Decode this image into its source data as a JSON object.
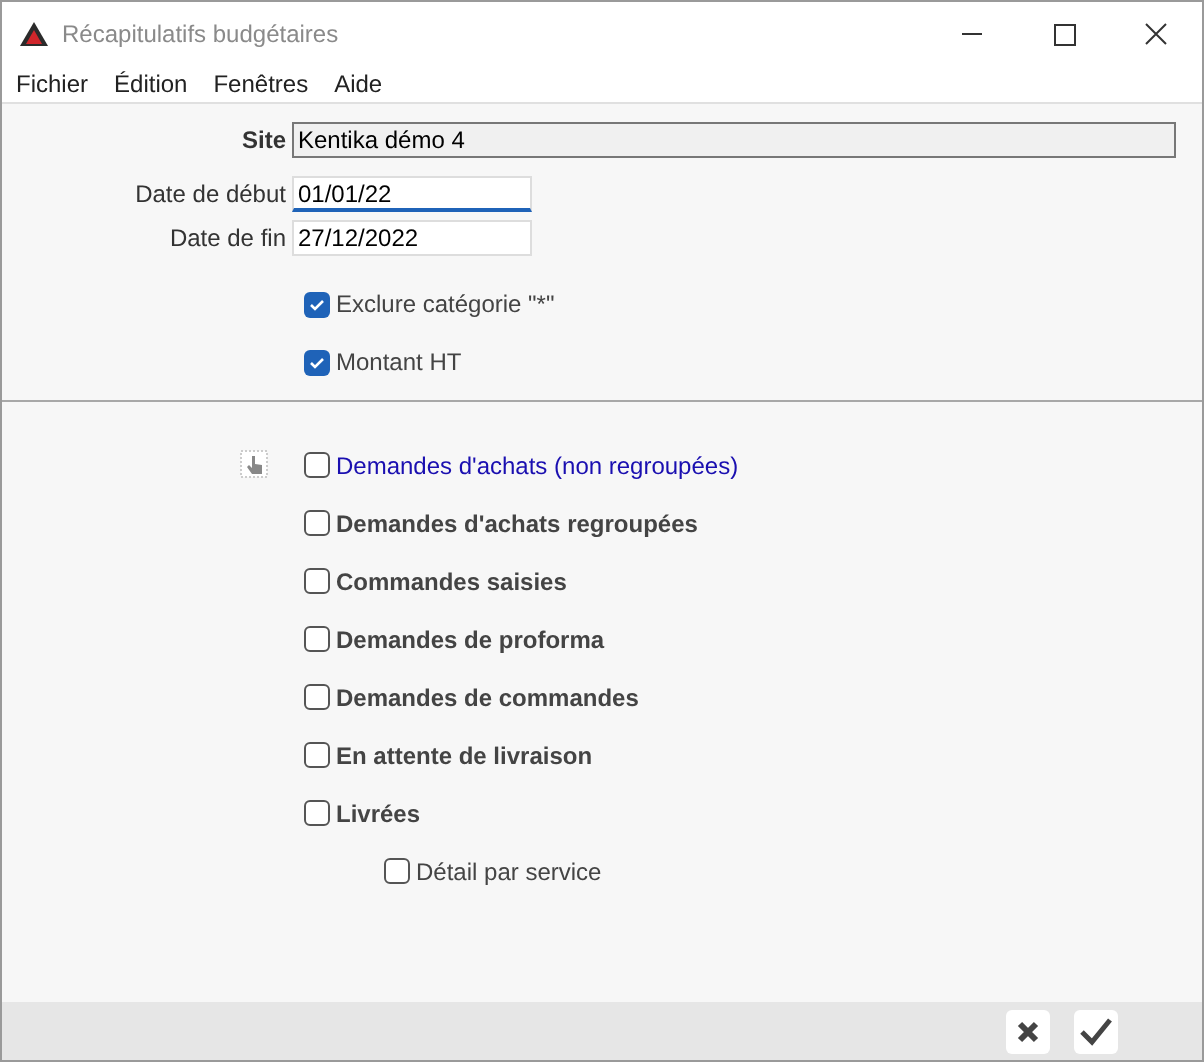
{
  "window": {
    "title": "Récapitulatifs budgétaires"
  },
  "menu": [
    "Fichier",
    "Édition",
    "Fenêtres",
    "Aide"
  ],
  "fields": [
    {
      "label": "Site",
      "value": "Kentika démo 4",
      "kind": "readonly",
      "focused": false
    },
    {
      "label": "Date de début",
      "value": "01/01/22",
      "kind": "input",
      "focused": true
    },
    {
      "label": "Date de fin",
      "value": "27/12/2022",
      "kind": "input",
      "focused": false
    }
  ],
  "options": [
    {
      "label": "Exclure catégorie \"*\"",
      "checked": true
    },
    {
      "label": "Montant HT",
      "checked": true
    }
  ],
  "reports": [
    {
      "label": "Demandes d'achats (non regroupées)",
      "checked": false,
      "highlighted": true
    },
    {
      "label": "Demandes d'achats regroupées",
      "checked": false,
      "highlighted": false
    },
    {
      "label": "Commandes saisies",
      "checked": false,
      "highlighted": false
    },
    {
      "label": "Demandes de proforma",
      "checked": false,
      "highlighted": false
    },
    {
      "label": "Demandes de commandes",
      "checked": false,
      "highlighted": false
    },
    {
      "label": "En attente de livraison",
      "checked": false,
      "highlighted": false
    },
    {
      "label": "Livrées",
      "checked": false,
      "highlighted": false,
      "children": [
        {
          "label": "Détail par service",
          "checked": false,
          "highlighted": false
        }
      ]
    }
  ]
}
